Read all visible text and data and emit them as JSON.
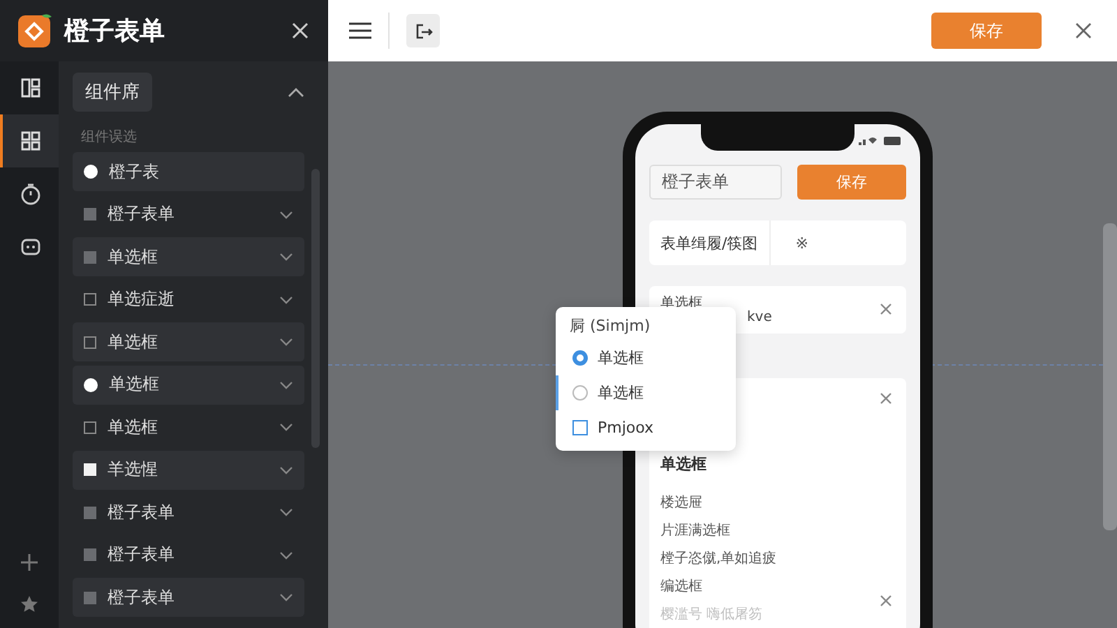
{
  "app": {
    "title": "橙子表单"
  },
  "panel": {
    "chip": "组件席",
    "expanded": true,
    "section_label": "组件误选"
  },
  "rail": [
    {
      "kind": "layout",
      "selected": false
    },
    {
      "kind": "grid",
      "selected": true
    },
    {
      "kind": "timer",
      "selected": false
    },
    {
      "kind": "bot",
      "selected": false
    }
  ],
  "items": [
    {
      "label": "橙子表",
      "kind": "dot",
      "highlighted": true,
      "expandable": false
    },
    {
      "label": "橙子表单",
      "kind": "gray",
      "highlighted": false,
      "expandable": true
    },
    {
      "label": "单选框",
      "kind": "gray",
      "highlighted": true,
      "expandable": true
    },
    {
      "label": "单选症逝",
      "kind": "outline",
      "highlighted": false,
      "expandable": true
    },
    {
      "label": "单选框",
      "kind": "outline",
      "highlighted": true,
      "expandable": true
    },
    {
      "label": "单选框",
      "kind": "dot",
      "highlighted": true,
      "expandable": true
    },
    {
      "label": "单选框",
      "kind": "outline",
      "highlighted": false,
      "expandable": true
    },
    {
      "label": "羊选惺",
      "kind": "white",
      "highlighted": true,
      "expandable": true
    },
    {
      "label": "橙子表单",
      "kind": "gray",
      "highlighted": false,
      "expandable": true
    },
    {
      "label": "橙子表单",
      "kind": "gray",
      "highlighted": false,
      "expandable": true
    },
    {
      "label": "橙子表单",
      "kind": "gray",
      "highlighted": true,
      "expandable": true
    }
  ],
  "toolbar": {
    "save": "保存"
  },
  "phone": {
    "title_value": "橙子表单",
    "save": "保存",
    "row": {
      "label": "表单缉履/筷图",
      "value": "※"
    },
    "card1": {
      "title": "单选框",
      "value": "kve"
    },
    "card2": {
      "title": "单选框",
      "lines": [
        {
          "text": "楼选屉",
          "faded": false
        },
        {
          "text": "片涯满选框",
          "faded": false
        },
        {
          "text": "樘子恣僦,单如追疲",
          "faded": false
        },
        {
          "text": "编选框",
          "faded": false
        },
        {
          "text": "樱滥号 嗨低屠笏",
          "faded": true
        }
      ]
    }
  },
  "popover": {
    "title": "屙 (Simjm)",
    "options": [
      {
        "kind": "radio",
        "label": "单选框",
        "selected": true,
        "hovered": false
      },
      {
        "kind": "radio",
        "label": "单选框",
        "selected": false,
        "hovered": true
      },
      {
        "kind": "checkbox",
        "label": "Pmjoox",
        "selected": false,
        "hovered": false
      }
    ]
  }
}
